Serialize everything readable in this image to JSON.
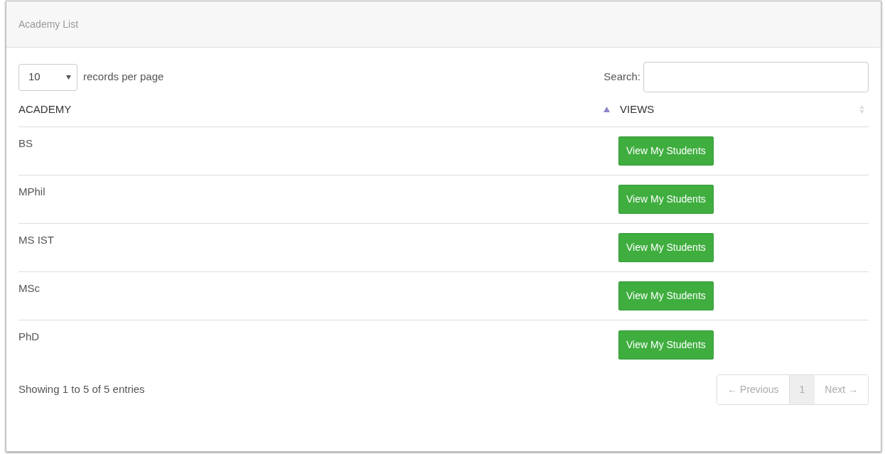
{
  "panel": {
    "title": "Academy List"
  },
  "length_menu": {
    "value": "10",
    "label": "records per page"
  },
  "search": {
    "label": "Search:"
  },
  "table": {
    "columns": [
      {
        "label": "ACADEMY",
        "sorted_ascending": true
      },
      {
        "label": "VIEWS",
        "sorted_ascending": false
      }
    ],
    "rows": [
      {
        "academy": "BS",
        "action": "View My Students"
      },
      {
        "academy": "MPhil",
        "action": "View My Students"
      },
      {
        "academy": "MS IST",
        "action": "View My Students"
      },
      {
        "academy": "MSc",
        "action": "View My Students"
      },
      {
        "academy": "PhD",
        "action": "View My Students"
      }
    ]
  },
  "info": "Showing 1 to 5 of 5 entries",
  "pagination": {
    "previous": "← Previous",
    "pages": [
      {
        "label": "1",
        "selected": true
      }
    ],
    "next": "Next →"
  }
}
